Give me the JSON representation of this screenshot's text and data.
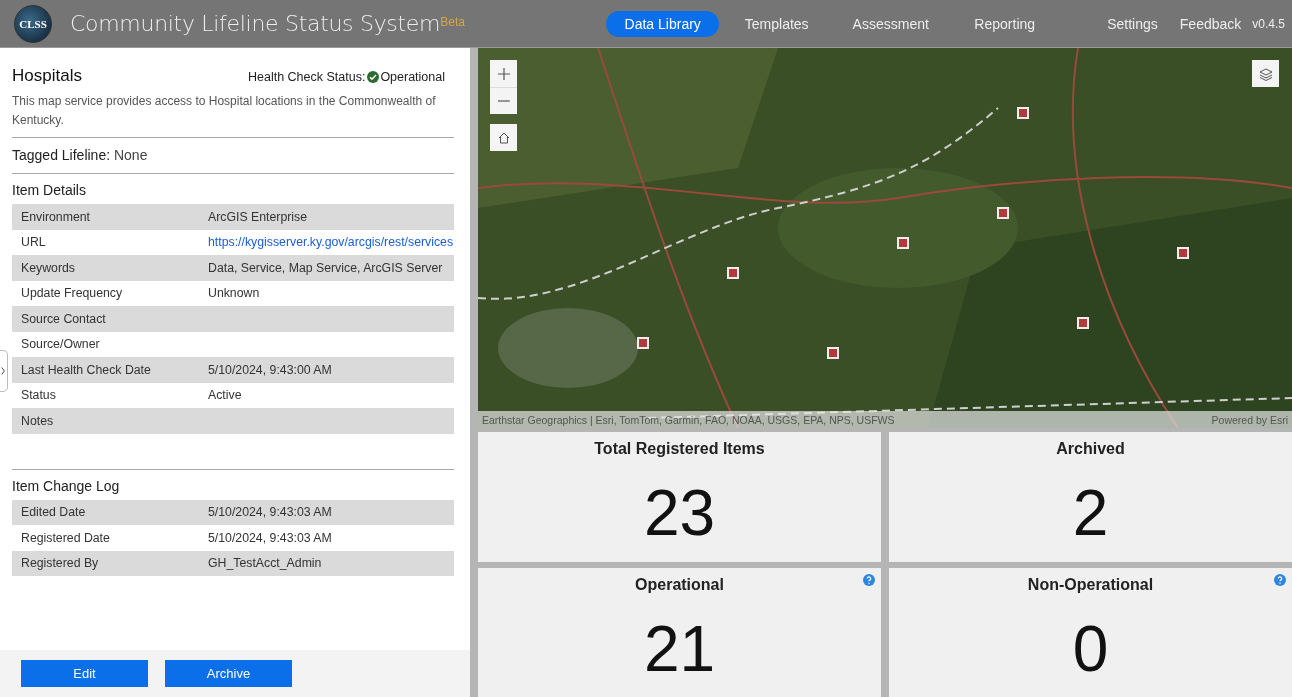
{
  "header": {
    "logo": "CLSS",
    "title": "Community Lifeline Status System",
    "badge": "Beta",
    "nav": [
      {
        "label": "Data Library",
        "selected": true
      },
      {
        "label": "Templates",
        "selected": false
      },
      {
        "label": "Assessment",
        "selected": false
      },
      {
        "label": "Reporting",
        "selected": false
      }
    ],
    "links": [
      "Settings",
      "Feedback"
    ],
    "version": "v0.4.5"
  },
  "item": {
    "title": "Hospitals",
    "health_label": "Health Check Status:",
    "health_status": "Operational",
    "description": "This map service provides access to Hospital locations in the Commonwealth of Kentucky.",
    "tagged_label": "Tagged Lifeline:",
    "tagged_value": "None",
    "details_title": "Item Details",
    "details": [
      {
        "label": "Environment",
        "value": "ArcGIS Enterprise"
      },
      {
        "label": "URL",
        "value": "https://kygisserver.ky.gov/arcgis/rest/services",
        "kind": "link"
      },
      {
        "label": "Keywords",
        "value": "Data, Service, Map Service, ArcGIS Server"
      },
      {
        "label": "Update Frequency",
        "value": "Unknown"
      },
      {
        "label": "Source Contact"
      },
      {
        "label": "Source/Owner"
      },
      {
        "label": "Last Health Check Date",
        "value": "5/10/2024, 9:43:00 AM"
      },
      {
        "label": "Status",
        "value": "Active"
      },
      {
        "label": "Notes"
      }
    ],
    "changelog_title": "Item Change Log",
    "changelog": [
      {
        "label": "Edited Date",
        "value": "5/10/2024, 9:43:03 AM"
      },
      {
        "label": "Registered Date",
        "value": "5/10/2024, 9:43:03 AM"
      },
      {
        "label": "Registered By",
        "value": "GH_TestAcct_Admin"
      }
    ]
  },
  "actions": [
    "Edit",
    "Archive"
  ],
  "map": {
    "attribution": "Earthstar Geographics | Esri, TomTom, Garmin, FAO, NOAA, USGS, EPA, NPS, USFWS",
    "powered_by": "Powered by Esri"
  },
  "stats": [
    {
      "title": "Total Registered Items",
      "value": "23",
      "help": false
    },
    {
      "title": "Archived",
      "value": "2",
      "help": false
    },
    {
      "title": "Operational",
      "value": "21",
      "help": true
    },
    {
      "title": "Non-Operational",
      "value": "0",
      "help": true
    }
  ]
}
